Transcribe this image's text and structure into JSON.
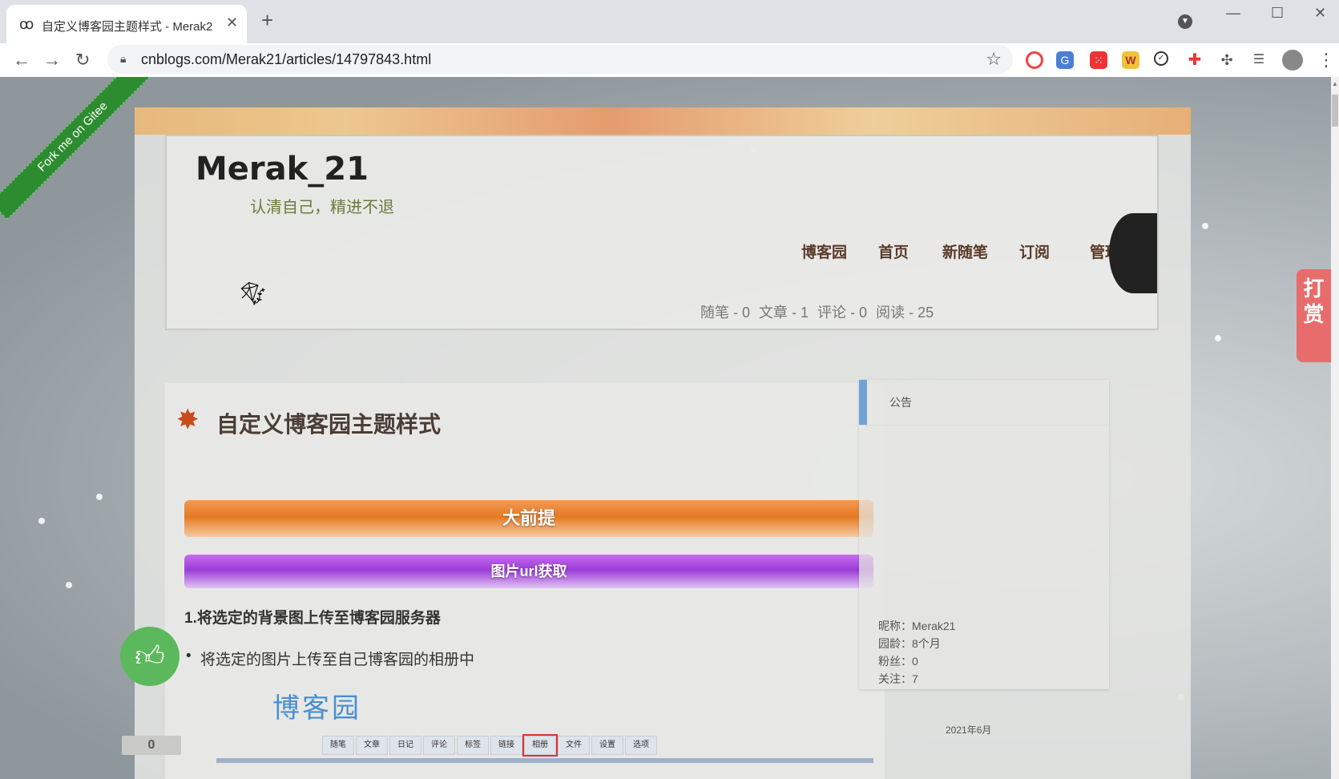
{
  "browser": {
    "tab_title": "自定义博客园主题样式 - Merak2",
    "tab_close": "✕",
    "new_tab": "+",
    "url": "cnblogs.com/Merak21/articles/14797843.html",
    "window_controls": [
      "—",
      "☐",
      "✕"
    ]
  },
  "page": {
    "ribbon_text": "Fork me on Gitee",
    "blog_title": "Merak_21",
    "blog_subtitle": "认清自己，精进不退",
    "nav": [
      "博客园",
      "首页",
      "新随笔",
      "订阅",
      "管理"
    ],
    "stats": [
      "随笔 - 0",
      "文章 - 1",
      "评论 - 0",
      "阅读 - 25"
    ],
    "post": {
      "title": "自定义博客园主题样式",
      "bar1": "大前提",
      "bar2": "图片url获取",
      "heading": "1.将选定的背景图上传至博客园服务器",
      "bullet": "将选定的图片上传至自己博客园的相册中",
      "image_logo": "博客园",
      "image_tabs": [
        "随笔",
        "文章",
        "日记",
        "评论",
        "标签",
        "链接",
        "相册",
        "文件",
        "设置",
        "选项"
      ]
    },
    "sidebar": {
      "title": "公告",
      "nickname_label": "昵称：",
      "nickname": "Merak21",
      "age_label": "园龄：",
      "age": "8个月",
      "fans_label": "粉丝：",
      "fans": "0",
      "follow_label": "关注：",
      "follow": "7"
    },
    "calendar_peek": "2021年6月",
    "like_count": "0",
    "reward": "打赏"
  }
}
